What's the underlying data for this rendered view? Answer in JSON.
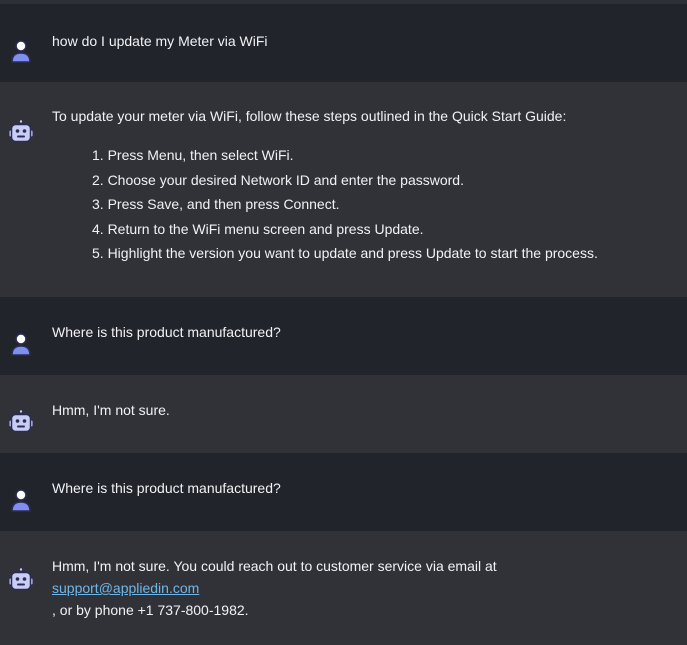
{
  "conversation": [
    {
      "role": "user",
      "icon": "user-icon",
      "text": "how do I update my Meter via WiFi"
    },
    {
      "role": "bot",
      "icon": "robot-icon",
      "intro": "To update your meter via WiFi, follow these steps outlined in the Quick Start Guide:",
      "steps": [
        "1. Press Menu, then select WiFi.",
        "2. Choose your desired Network ID and enter the password.",
        "3. Press Save, and then press Connect.",
        "4. Return to the WiFi menu screen and press Update.",
        "5. Highlight the version you want to update and press Update to start the process."
      ]
    },
    {
      "role": "user",
      "icon": "user-icon",
      "text": "Where is this product manufactured?"
    },
    {
      "role": "bot",
      "icon": "robot-icon",
      "text": "Hmm, I'm not sure."
    },
    {
      "role": "user",
      "icon": "user-icon",
      "text": "Where is this product manufactured?"
    },
    {
      "role": "bot",
      "icon": "robot-icon",
      "text": "Hmm, I'm not sure. You could reach out to customer service via email at",
      "email": "support@appliedin.com",
      "after": ", or by phone +1 737-800-1982."
    }
  ],
  "colors": {
    "user_bg": "#22242b",
    "bot_bg": "#303238",
    "link": "#6eb7ea",
    "user_avatar_body": "#7f8ff0",
    "robot_avatar": "#c9ccf5"
  }
}
